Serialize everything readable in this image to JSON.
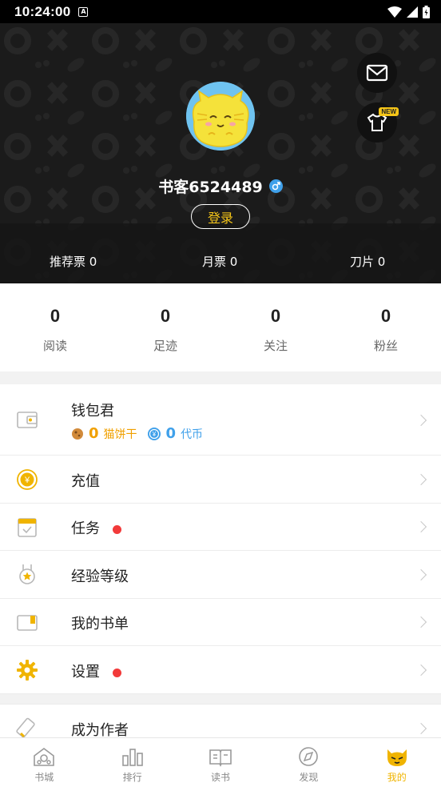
{
  "status_bar": {
    "time": "10:24:00",
    "notification_icon": "A"
  },
  "profile": {
    "username": "书客6524489",
    "login_label": "登录",
    "new_badge": "NEW",
    "tickets": [
      {
        "label": "推荐票 0"
      },
      {
        "label": "月票 0"
      },
      {
        "label": "刀片 0"
      }
    ]
  },
  "stats": [
    {
      "value": "0",
      "label": "阅读"
    },
    {
      "value": "0",
      "label": "足迹"
    },
    {
      "value": "0",
      "label": "关注"
    },
    {
      "value": "0",
      "label": "粉丝"
    }
  ],
  "wallet": {
    "title": "钱包君",
    "cookie_value": "0",
    "cookie_label": "猫饼干",
    "coin_value": "0",
    "coin_label": "代币"
  },
  "menu": {
    "recharge": "充值",
    "tasks": "任务",
    "level": "经验等级",
    "booklist": "我的书单",
    "settings": "设置",
    "author": "成为作者"
  },
  "bottom_nav": [
    {
      "label": "书城"
    },
    {
      "label": "排行"
    },
    {
      "label": "读书"
    },
    {
      "label": "发现"
    },
    {
      "label": "我的"
    }
  ],
  "colors": {
    "accent": "#f0b400",
    "header_bg": "#1b1b1b",
    "red_dot": "#f23a3a",
    "coin_blue": "#3fa0ea"
  }
}
